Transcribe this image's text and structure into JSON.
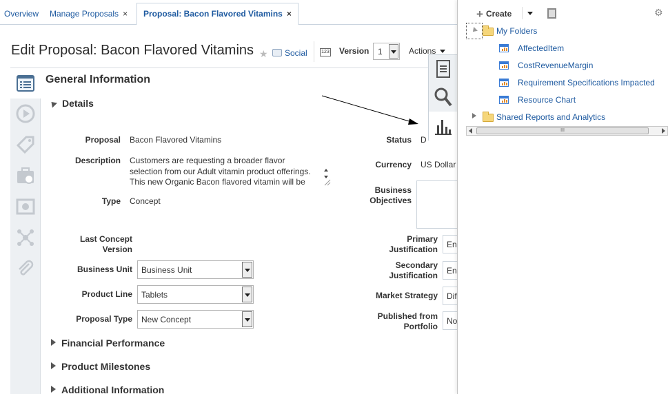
{
  "tabs": [
    {
      "label": "Overview"
    },
    {
      "label": "Manage Proposals",
      "close": "×"
    },
    {
      "label": "Proposal: Bacon Flavored Vitamins",
      "close": "×"
    }
  ],
  "header": {
    "title": "Edit Proposal: Bacon Flavored Vitamins",
    "social": "Social",
    "version_icon": "123",
    "version_label": "Version",
    "version_value": "1",
    "actions": "Actions"
  },
  "rail_icons": [
    "list-icon",
    "play-icon",
    "tag-icon",
    "briefcase-icon",
    "money-icon",
    "network-icon",
    "paperclip-icon"
  ],
  "side_tabs": [
    "document-icon",
    "search-icon",
    "bar-chart-icon"
  ],
  "section": {
    "title": "General Information",
    "details": "Details",
    "fields": {
      "proposal_label": "Proposal",
      "proposal_value": "Bacon Flavored Vitamins",
      "description_label": "Description",
      "description_lines": [
        "Customers are requesting a broader flavor",
        "selection from our Adult vitamin product offerings.",
        "This new Organic Bacon flavored vitamin will be"
      ],
      "type_label": "Type",
      "type_value": "Concept",
      "last_concept_label_1": "Last Concept",
      "last_concept_label_2": "Version",
      "business_unit_label": "Business Unit",
      "business_unit_value": "Business Unit",
      "product_line_label": "Product Line",
      "product_line_value": "Tablets",
      "proposal_type_label": "Proposal Type",
      "proposal_type_value": "New Concept",
      "status_label": "Status",
      "status_value": "D",
      "currency_label": "Currency",
      "currency_value": "US Dollar",
      "business_objectives_label_1": "Business",
      "business_objectives_label_2": "Objectives",
      "primary_label_1": "Primary",
      "primary_label_2": "Justification",
      "primary_value": "En",
      "secondary_label_1": "Secondary",
      "secondary_label_2": "Justification",
      "secondary_value": "En",
      "market_strategy_label": "Market Strategy",
      "market_strategy_value": "Dif",
      "published_label_1": "Published from",
      "published_label_2": "Portfolio",
      "published_value": "No"
    },
    "collapsed": [
      "Financial Performance",
      "Product Milestones",
      "Additional Information"
    ]
  },
  "right_panel": {
    "create": "Create",
    "my_folders": "My Folders",
    "reports": [
      "AffectedItem",
      "CostRevenueMargin",
      "Requirement Specifications Impacted",
      "Resource Chart"
    ],
    "shared": "Shared Reports and Analytics",
    "scroll_grip": "III"
  }
}
